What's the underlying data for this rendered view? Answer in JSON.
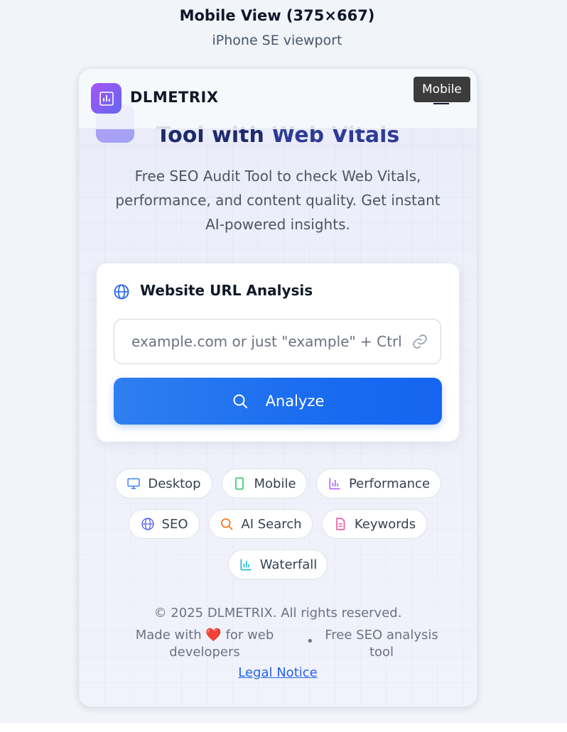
{
  "caption": {
    "title": "Mobile View (375×667)",
    "subtitle": "iPhone SE viewport"
  },
  "header": {
    "brand": "DLMETRIX",
    "tooltip": "Mobile",
    "logo_icon": "bar-chart-icon",
    "menu_icon": "hamburger-menu-icon"
  },
  "hero": {
    "title_line2_pre": "Tool with ",
    "title_line2_accent": "Web Vitals",
    "description": "Free SEO Audit Tool to check Web Vitals, performance, and content quality. Get instant AI-powered insights."
  },
  "analysis_card": {
    "title": "Website URL Analysis",
    "input_placeholder": "example.com or just \"example\" + Ctrl+Enter",
    "input_value": "",
    "analyze_label": "Analyze"
  },
  "chips": [
    {
      "label": "Desktop",
      "icon": "monitor-icon",
      "color": "#3b82f6"
    },
    {
      "label": "Mobile",
      "icon": "smartphone-icon",
      "color": "#22c55e"
    },
    {
      "label": "Performance",
      "icon": "bar-chart-icon",
      "color": "#a855f7"
    },
    {
      "label": "SEO",
      "icon": "globe-icon",
      "color": "#6366f1"
    },
    {
      "label": "AI Search",
      "icon": "search-icon",
      "color": "#f97316"
    },
    {
      "label": "Keywords",
      "icon": "document-icon",
      "color": "#ec4899"
    },
    {
      "label": "Waterfall",
      "icon": "bar-chart-icon",
      "color": "#06b6d4"
    }
  ],
  "footer": {
    "copyright": "© 2025 DLMETRIX. All rights reserved.",
    "made_with_pre": "Made with",
    "heart": "❤️",
    "made_with_post": "for web developers",
    "separator": "•",
    "tagline": "Free SEO analysis tool",
    "legal": "Legal Notice"
  },
  "colors": {
    "accent_blue": "#1a6cf0",
    "brand_gradient_start": "#a855f7",
    "brand_gradient_end": "#6366f1",
    "title_navy": "#1e2a6b"
  }
}
